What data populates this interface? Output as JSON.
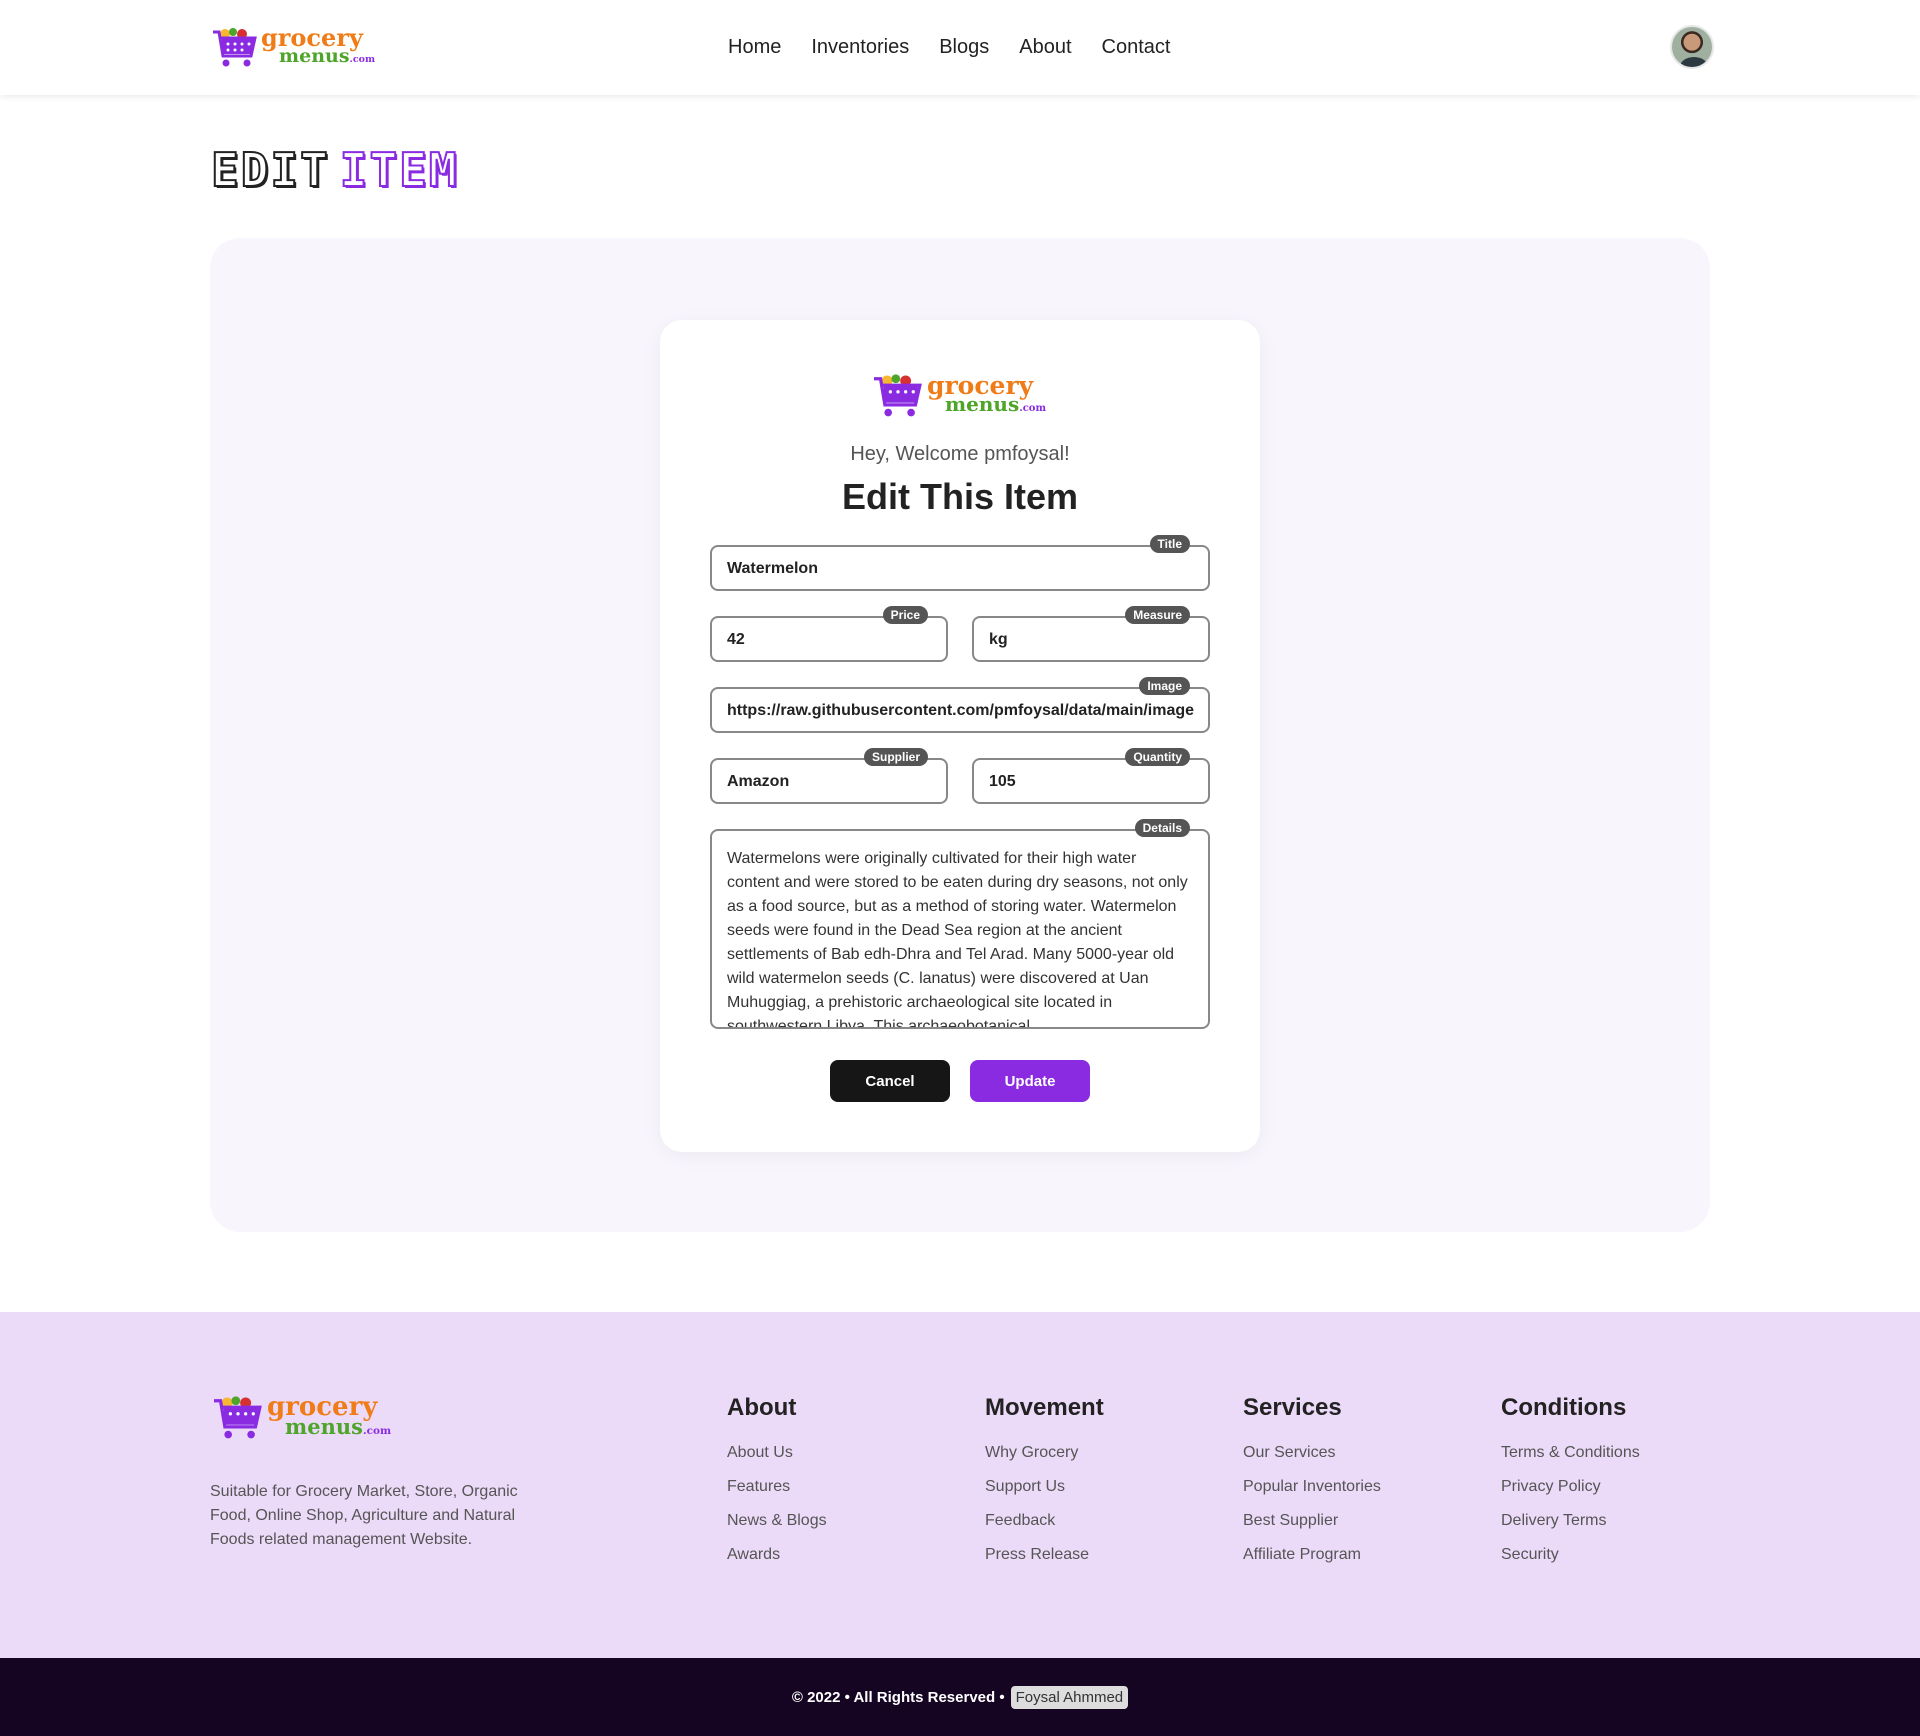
{
  "brand": {
    "line1": "grocery",
    "line2": "menus",
    "suffix": ".com"
  },
  "nav": [
    "Home",
    "Inventories",
    "Blogs",
    "About",
    "Contact"
  ],
  "page_title": {
    "word1": "EDIT",
    "word2": "ITEM"
  },
  "form": {
    "welcome": "Hey, Welcome pmfoysal!",
    "heading": "Edit This Item",
    "fields": {
      "title": {
        "label": "Title",
        "value": "Watermelon"
      },
      "price": {
        "label": "Price",
        "value": "42"
      },
      "measure": {
        "label": "Measure",
        "value": "kg"
      },
      "image": {
        "label": "Image",
        "value": "https://raw.githubusercontent.com/pmfoysal/data/main/images/watermelon.png"
      },
      "supplier": {
        "label": "Supplier",
        "value": "Amazon"
      },
      "quantity": {
        "label": "Quantity",
        "value": "105"
      },
      "details": {
        "label": "Details",
        "value": "Watermelons were originally cultivated for their high water content and were stored to be eaten during dry seasons, not only as a food source, but as a method of storing water. Watermelon seeds were found in the Dead Sea region at the ancient settlements of Bab edh-Dhra and Tel Arad. Many 5000-year old wild watermelon seeds (C. lanatus) were discovered at Uan Muhuggiag, a prehistoric archaeological site located in southwestern Libya. This archaeobotanical"
      }
    },
    "cancel_label": "Cancel",
    "update_label": "Update"
  },
  "footer": {
    "description": "Suitable for Grocery Market, Store, Organic Food, Online Shop, Agriculture and Natural Foods related management Website.",
    "columns": [
      {
        "title": "About",
        "links": [
          "About Us",
          "Features",
          "News & Blogs",
          "Awards"
        ]
      },
      {
        "title": "Movement",
        "links": [
          "Why Grocery",
          "Support Us",
          "Feedback",
          "Press Release"
        ]
      },
      {
        "title": "Services",
        "links": [
          "Our Services",
          "Popular Inventories",
          "Best Supplier",
          "Affiliate Program"
        ]
      },
      {
        "title": "Conditions",
        "links": [
          "Terms & Conditions",
          "Privacy Policy",
          "Delivery Terms",
          "Security"
        ]
      }
    ],
    "copyright": "© 2022 • All Rights Reserved •",
    "author": "Foysal Ahmmed"
  },
  "colors": {
    "accent": "#8a2be2",
    "footer_bg": "#ebdaf8",
    "bottom_bar": "#160522"
  },
  "icons": [
    "cart-logo-icon",
    "user-avatar"
  ]
}
